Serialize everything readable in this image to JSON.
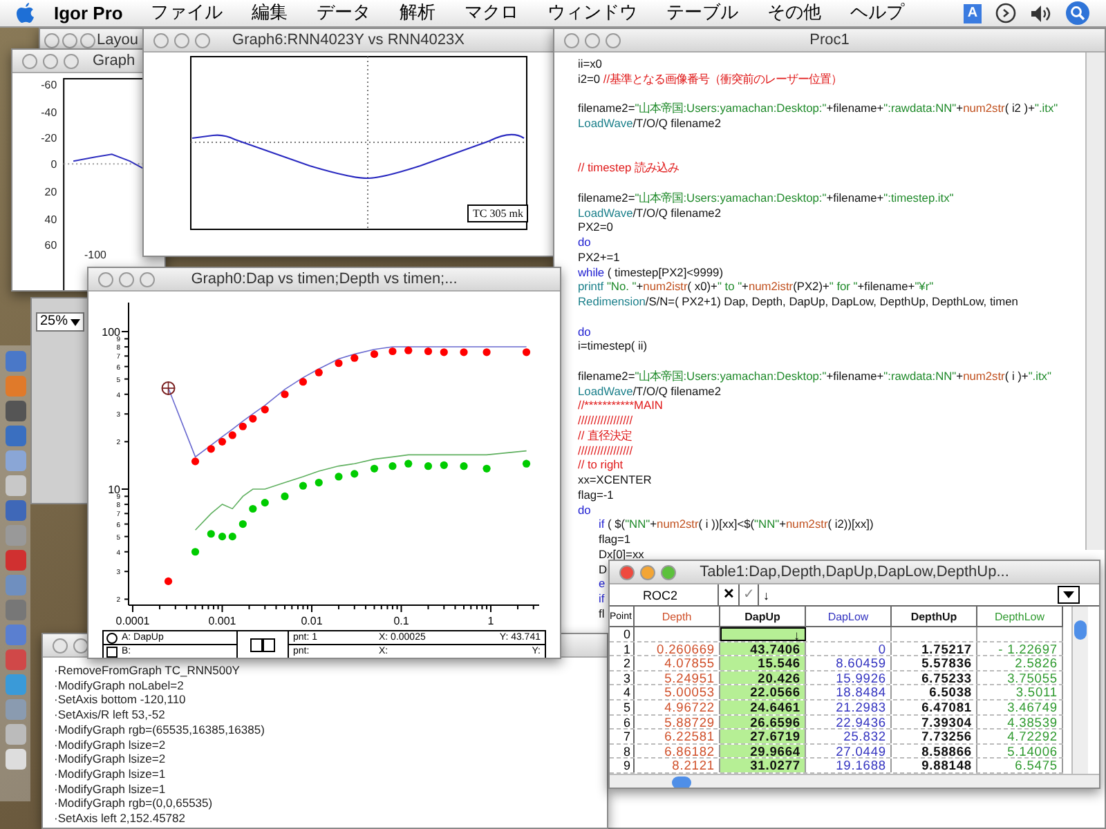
{
  "menu_bar": {
    "app_name": "Igor Pro",
    "menus": [
      "ファイル",
      "編集",
      "データ",
      "解析",
      "マクロ",
      "ウィンドウ",
      "テーブル",
      "その他",
      "ヘルプ"
    ],
    "input_indicator": "A"
  },
  "layout_window": {
    "title": "Layou"
  },
  "graph_window": {
    "title": "Graph",
    "y_ticks": [
      "-60",
      "-40",
      "-20",
      "0",
      "20",
      "40",
      "60"
    ],
    "x_ticks": [
      "-100"
    ]
  },
  "graph6_window": {
    "title": "Graph6:RNN4023Y vs RNN4023X",
    "legend": "TC 305 mk"
  },
  "zoom_popup": {
    "value": "25%"
  },
  "proc1_window": {
    "title": "Proc1",
    "lines": [
      {
        "kind": "code",
        "segments": [
          {
            "kind": "plain",
            "text": "ii=x0"
          }
        ]
      },
      {
        "kind": "code",
        "segments": [
          {
            "kind": "plain",
            "text": "i2=0 "
          },
          {
            "kind": "comment",
            "text": "//基準となる画像番号（衝突前のレーザー位置）"
          }
        ]
      },
      {
        "kind": "blank"
      },
      {
        "kind": "code",
        "segments": [
          {
            "kind": "plain",
            "text": "filename2="
          },
          {
            "kind": "string",
            "text": "\"山本帝国:Users:yamachan:Desktop:\""
          },
          {
            "kind": "plain",
            "text": "+filename+"
          },
          {
            "kind": "string",
            "text": "\":rawdata:NN\""
          },
          {
            "kind": "plain",
            "text": "+"
          },
          {
            "kind": "function",
            "text": "num2str"
          },
          {
            "kind": "plain",
            "text": "( i2 )+"
          },
          {
            "kind": "string",
            "text": "\".itx\""
          }
        ]
      },
      {
        "kind": "code",
        "segments": [
          {
            "kind": "operation",
            "text": "LoadWave"
          },
          {
            "kind": "plain",
            "text": "/T/O/Q filename2"
          }
        ]
      },
      {
        "kind": "blank"
      },
      {
        "kind": "blank"
      },
      {
        "kind": "code",
        "segments": [
          {
            "kind": "comment",
            "text": "// timestep 読み込み"
          }
        ]
      },
      {
        "kind": "blank"
      },
      {
        "kind": "code",
        "segments": [
          {
            "kind": "plain",
            "text": "filename2="
          },
          {
            "kind": "string",
            "text": "\"山本帝国:Users:yamachan:Desktop:\""
          },
          {
            "kind": "plain",
            "text": "+filename+"
          },
          {
            "kind": "string",
            "text": "\":timestep.itx\""
          }
        ]
      },
      {
        "kind": "code",
        "segments": [
          {
            "kind": "operation",
            "text": "LoadWave"
          },
          {
            "kind": "plain",
            "text": "/T/O/Q filename2"
          }
        ]
      },
      {
        "kind": "code",
        "segments": [
          {
            "kind": "plain",
            "text": "PX2=0"
          }
        ]
      },
      {
        "kind": "code",
        "segments": [
          {
            "kind": "keyword",
            "text": "do"
          }
        ]
      },
      {
        "kind": "code",
        "segments": [
          {
            "kind": "plain",
            "text": "PX2+=1"
          }
        ]
      },
      {
        "kind": "code",
        "segments": [
          {
            "kind": "keyword",
            "text": "while"
          },
          {
            "kind": "plain",
            "text": " ( timestep[PX2]<9999)"
          }
        ]
      },
      {
        "kind": "code",
        "segments": [
          {
            "kind": "operation",
            "text": "printf"
          },
          {
            "kind": "string",
            "text": " \"No. \""
          },
          {
            "kind": "plain",
            "text": "+"
          },
          {
            "kind": "function",
            "text": "num2istr"
          },
          {
            "kind": "plain",
            "text": "( x0)+"
          },
          {
            "kind": "string",
            "text": "\" to \""
          },
          {
            "kind": "plain",
            "text": "+"
          },
          {
            "kind": "function",
            "text": "num2istr"
          },
          {
            "kind": "plain",
            "text": "(PX2)+"
          },
          {
            "kind": "string",
            "text": "\" for \""
          },
          {
            "kind": "plain",
            "text": "+filename+"
          },
          {
            "kind": "string",
            "text": "\"¥r\""
          }
        ]
      },
      {
        "kind": "code",
        "segments": [
          {
            "kind": "operation",
            "text": "Redimension"
          },
          {
            "kind": "plain",
            "text": "/S/N=( PX2+1) Dap, Depth, DapUp, DapLow, DepthUp, DepthLow, timen"
          }
        ]
      },
      {
        "kind": "blank"
      },
      {
        "kind": "code",
        "segments": [
          {
            "kind": "keyword",
            "text": "do"
          }
        ]
      },
      {
        "kind": "code",
        "segments": [
          {
            "kind": "plain",
            "text": "i=timestep( ii)"
          }
        ]
      },
      {
        "kind": "blank"
      },
      {
        "kind": "code",
        "segments": [
          {
            "kind": "plain",
            "text": "filename2="
          },
          {
            "kind": "string",
            "text": "\"山本帝国:Users:yamachan:Desktop:\""
          },
          {
            "kind": "plain",
            "text": "+filename+"
          },
          {
            "kind": "string",
            "text": "\":rawdata:NN\""
          },
          {
            "kind": "plain",
            "text": "+"
          },
          {
            "kind": "function",
            "text": "num2str"
          },
          {
            "kind": "plain",
            "text": "( i )+"
          },
          {
            "kind": "string",
            "text": "\".itx\""
          }
        ]
      },
      {
        "kind": "code",
        "segments": [
          {
            "kind": "operation",
            "text": "LoadWave"
          },
          {
            "kind": "plain",
            "text": "/T/O/Q filename2"
          }
        ]
      },
      {
        "kind": "code",
        "segments": [
          {
            "kind": "comment",
            "text": "//***********MAIN"
          }
        ]
      },
      {
        "kind": "code",
        "segments": [
          {
            "kind": "comment",
            "text": "/////////////////"
          }
        ]
      },
      {
        "kind": "code",
        "segments": [
          {
            "kind": "comment",
            "text": "// 直径決定"
          }
        ]
      },
      {
        "kind": "code",
        "segments": [
          {
            "kind": "comment",
            "text": "/////////////////"
          }
        ]
      },
      {
        "kind": "code",
        "segments": [
          {
            "kind": "comment",
            "text": "// to right"
          }
        ]
      },
      {
        "kind": "code",
        "segments": [
          {
            "kind": "plain",
            "text": "xx=XCENTER"
          }
        ]
      },
      {
        "kind": "code",
        "segments": [
          {
            "kind": "plain",
            "text": "flag=-1"
          }
        ]
      },
      {
        "kind": "code",
        "segments": [
          {
            "kind": "keyword",
            "text": "do"
          }
        ],
        "children": [
          {
            "kind": "code",
            "segments": [
              {
                "kind": "keyword",
                "text": "if"
              },
              {
                "kind": "plain",
                "text": " ( $("
              },
              {
                "kind": "string",
                "text": "\"NN\""
              },
              {
                "kind": "plain",
                "text": "+"
              },
              {
                "kind": "function",
                "text": "num2str"
              },
              {
                "kind": "plain",
                "text": "( i ))[xx]<$("
              },
              {
                "kind": "string",
                "text": "\"NN\""
              },
              {
                "kind": "plain",
                "text": "+"
              },
              {
                "kind": "function",
                "text": "num2str"
              },
              {
                "kind": "plain",
                "text": "( i2))[xx])"
              }
            ]
          },
          {
            "kind": "code",
            "segments": [
              {
                "kind": "plain",
                "text": "flag=1"
              }
            ]
          },
          {
            "kind": "code",
            "segments": [
              {
                "kind": "plain",
                "text": "Dx[0]=xx"
              }
            ]
          },
          {
            "kind": "code",
            "segments": [
              {
                "kind": "plain",
                "text": "D"
              }
            ]
          },
          {
            "kind": "code",
            "segments": [
              {
                "kind": "keyword",
                "text": "e"
              }
            ]
          },
          {
            "kind": "code",
            "segments": [
              {
                "kind": "keyword",
                "text": "if"
              }
            ]
          },
          {
            "kind": "code",
            "segments": [
              {
                "kind": "plain",
                "text": "fl"
              }
            ]
          }
        ]
      }
    ]
  },
  "graph0_window": {
    "title": "Graph0:Dap vs timen;Depth vs timen;...",
    "x_tick_labels": [
      "0.0001",
      "0.001",
      "0.01",
      "0.1",
      "1"
    ],
    "y_tick_labels": [
      "100",
      "9",
      "8",
      "7",
      "6",
      "5",
      "4",
      "3",
      "2",
      "10",
      "9",
      "8",
      "7",
      "6",
      "5",
      "4",
      "3",
      "2"
    ],
    "cursors": [
      {
        "kind": "circle",
        "label": "A: DapUp",
        "pnt": "pnt: 1",
        "x": "X: 0.00025",
        "y": "Y: 43.741"
      },
      {
        "kind": "square",
        "label": "B:",
        "pnt": "pnt:",
        "x": "X:",
        "y": "Y:"
      }
    ]
  },
  "command_window": {
    "history": [
      "·RemoveFromGraph TC_RNN500Y",
      "·ModifyGraph noLabel=2",
      "·SetAxis bottom -120,110",
      "·SetAxis/R left 53,-52",
      "·ModifyGraph rgb=(65535,16385,16385)",
      "·ModifyGraph lsize=2",
      "·ModifyGraph lsize=2",
      "·ModifyGraph lsize=1",
      "·ModifyGraph lsize=1",
      "·ModifyGraph rgb=(0,0,65535)",
      "·SetAxis left 2,152.45782"
    ]
  },
  "table_window": {
    "title": "Table1:Dap,Depth,DapUp,DapLow,DepthUp...",
    "entry_name": "ROC2",
    "cancel": "✕",
    "accept": "✓",
    "entry_value": "↓",
    "point_header": "Point",
    "columns": [
      {
        "label": "Depth",
        "color": "#d0502a",
        "bold": false,
        "selected": false
      },
      {
        "label": "DapUp",
        "color": "#111111",
        "bold": true,
        "selected": true
      },
      {
        "label": "DapLow",
        "color": "#3333c0",
        "bold": false,
        "selected": false
      },
      {
        "label": "DepthUp",
        "color": "#111111",
        "bold": true,
        "selected": false
      },
      {
        "label": "DepthLow",
        "color": "#2f9a2f",
        "bold": false,
        "selected": false
      }
    ],
    "rows": [
      {
        "point": "0",
        "cells": [
          null,
          "↓",
          null,
          null,
          null
        ]
      },
      {
        "point": "1",
        "cells": [
          "0.260669",
          "43.7406",
          "0",
          "1.75217",
          "- 1.22697"
        ]
      },
      {
        "point": "2",
        "cells": [
          "4.07855",
          "15.546",
          "8.60459",
          "5.57836",
          "2.5826"
        ]
      },
      {
        "point": "3",
        "cells": [
          "5.24951",
          "20.426",
          "15.9926",
          "6.75233",
          "3.75055"
        ]
      },
      {
        "point": "4",
        "cells": [
          "5.00053",
          "22.0566",
          "18.8484",
          "6.5038",
          "3.5011"
        ]
      },
      {
        "point": "5",
        "cells": [
          "4.96722",
          "24.6461",
          "21.2983",
          "6.47081",
          "3.46749"
        ]
      },
      {
        "point": "6",
        "cells": [
          "5.88729",
          "26.6596",
          "22.9436",
          "7.39304",
          "4.38539"
        ]
      },
      {
        "point": "7",
        "cells": [
          "6.22581",
          "27.6719",
          "25.832",
          "7.73256",
          "4.72292"
        ]
      },
      {
        "point": "8",
        "cells": [
          "6.86182",
          "29.9664",
          "27.0449",
          "8.58866",
          "5.14006"
        ]
      },
      {
        "point": "9",
        "cells": [
          "8.2121",
          "31.0277",
          "19.1688",
          "9.88148",
          "6.5475"
        ]
      }
    ]
  }
}
